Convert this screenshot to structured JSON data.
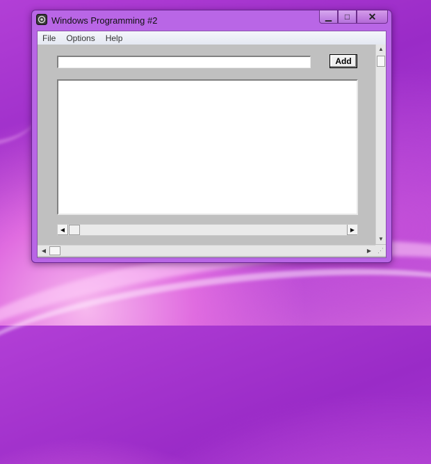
{
  "window": {
    "title": "Windows Programming #2",
    "controls": {
      "minimize_glyph": "▁",
      "maximize_glyph": "□",
      "close_glyph": "✕"
    }
  },
  "menubar": {
    "items": [
      {
        "label": "File"
      },
      {
        "label": "Options"
      },
      {
        "label": "Help"
      }
    ]
  },
  "form": {
    "text_input": {
      "value": "",
      "placeholder": ""
    },
    "add_button_label": "Add",
    "listbox_items": []
  },
  "scrollbars": {
    "left_arrow": "◀",
    "right_arrow": "▶",
    "up_arrow": "▲",
    "down_arrow": "▼",
    "grip": "⋰"
  },
  "colors": {
    "desktop_accent": "#a83bd2",
    "window_frame": "#b966e6",
    "client_bg": "#c0c0c0"
  },
  "icons": [
    "app-icon",
    "minimize-icon",
    "maximize-icon",
    "close-icon",
    "scroll-left-icon",
    "scroll-right-icon",
    "scroll-up-icon",
    "scroll-down-icon",
    "size-grip-icon"
  ]
}
